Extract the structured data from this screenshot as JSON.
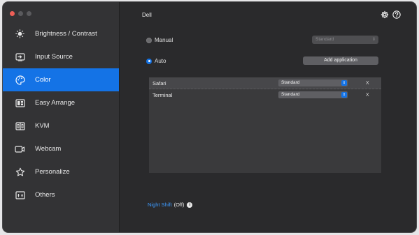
{
  "window": {
    "title": "Dell"
  },
  "sidebar": {
    "items": [
      {
        "label": "Brightness / Contrast",
        "icon": "brightness-icon"
      },
      {
        "label": "Input Source",
        "icon": "input-source-icon"
      },
      {
        "label": "Color",
        "icon": "color-palette-icon",
        "active": true
      },
      {
        "label": "Easy Arrange",
        "icon": "easy-arrange-icon"
      },
      {
        "label": "KVM",
        "icon": "kvm-icon"
      },
      {
        "label": "Webcam",
        "icon": "webcam-icon"
      },
      {
        "label": "Personalize",
        "icon": "star-icon"
      },
      {
        "label": "Others",
        "icon": "others-icon"
      }
    ]
  },
  "color": {
    "manual_label": "Manual",
    "manual_preset": "Standard",
    "auto_label": "Auto",
    "add_application_label": "Add application",
    "apps": [
      {
        "name": "Safari",
        "preset": "Standard",
        "remove": "X"
      },
      {
        "name": "Terminal",
        "preset": "Standard",
        "remove": "X"
      }
    ],
    "night_shift_label": "Night Shift",
    "night_shift_state": "(Off)"
  },
  "colors": {
    "accent": "#1473e6",
    "window_bg": "#2a2a2c",
    "sidebar_bg": "#333335"
  }
}
